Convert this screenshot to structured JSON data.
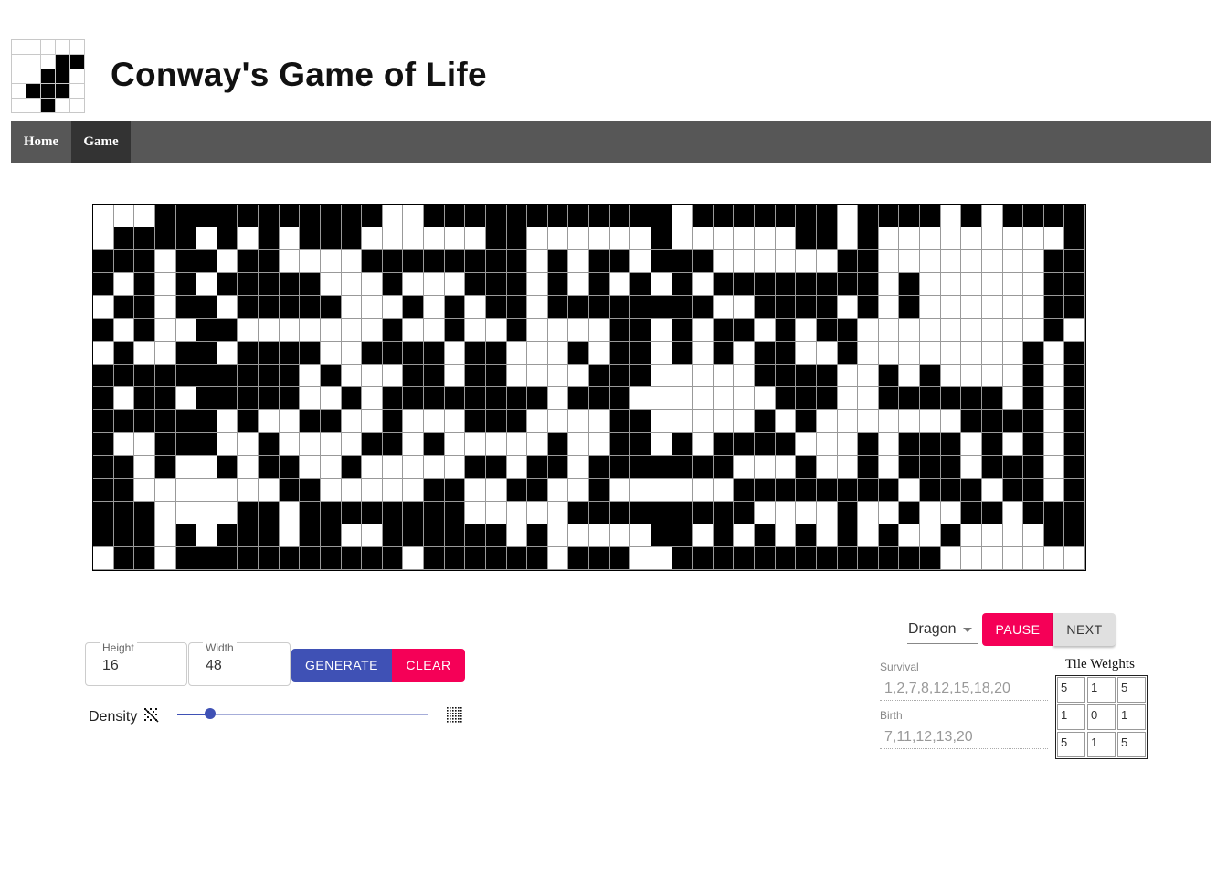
{
  "header": {
    "title": "Conway's Game of Life"
  },
  "logo": {
    "cells": [
      [
        0,
        0,
        0,
        0,
        0
      ],
      [
        0,
        0,
        0,
        1,
        1
      ],
      [
        0,
        0,
        1,
        1,
        0
      ],
      [
        0,
        1,
        1,
        1,
        0
      ],
      [
        0,
        0,
        1,
        0,
        0
      ]
    ]
  },
  "nav": {
    "items": [
      {
        "label": "Home"
      },
      {
        "label": "Game",
        "active": true
      }
    ]
  },
  "board": {
    "rows": 16,
    "cols": 48,
    "cells": [
      "000111111111110011111111111101111111011110101111111",
      "011110101011100000011000000100000011010000000001",
      "111011011000011111111010110111000000110000000011",
      "101010111110001000111010101010111111110100000011",
      "011011011111000101011011111111001111010100000011",
      "101001100000001001001000011010110101100000000010",
      "010011011110011110110001011010101100100000000101",
      "111111111101000110110000111000001111001010000101",
      "101101111100101111111101110000000111001111110101",
      "111111010011001000111000011000001010000000111101",
      "100111001000011010000010011010111100010111010101",
      "110100101100100000110110111111100010010111011101",
      "110000000110000011001100100000011111111011101101",
      "111000011011111111000001111111110000100100110111",
      "111010111011001111110100000110101010101001000011",
      "011011111111111011111101110011111111111110000000"
    ]
  },
  "controls": {
    "height": {
      "label": "Height",
      "value": "16"
    },
    "width": {
      "label": "Width",
      "value": "48"
    },
    "generate_label": "GENERATE",
    "clear_label": "CLEAR",
    "density_label": "Density",
    "density_value": 0.13
  },
  "rules": {
    "preset": "Dragon",
    "pause_label": "PAUSE",
    "next_label": "NEXT",
    "survival_label": "Survival",
    "survival_value": "1,2,7,8,12,15,18,20",
    "birth_label": "Birth",
    "birth_value": "7,11,12,13,20"
  },
  "tile_weights": {
    "title": "Tile Weights",
    "values": [
      [
        "5",
        "1",
        "5"
      ],
      [
        "1",
        "0",
        "1"
      ],
      [
        "5",
        "1",
        "5"
      ]
    ]
  },
  "colors": {
    "primary": "#3f51b5",
    "secondary": "#f50057",
    "nav": "#575757",
    "nav_active": "#333333"
  }
}
